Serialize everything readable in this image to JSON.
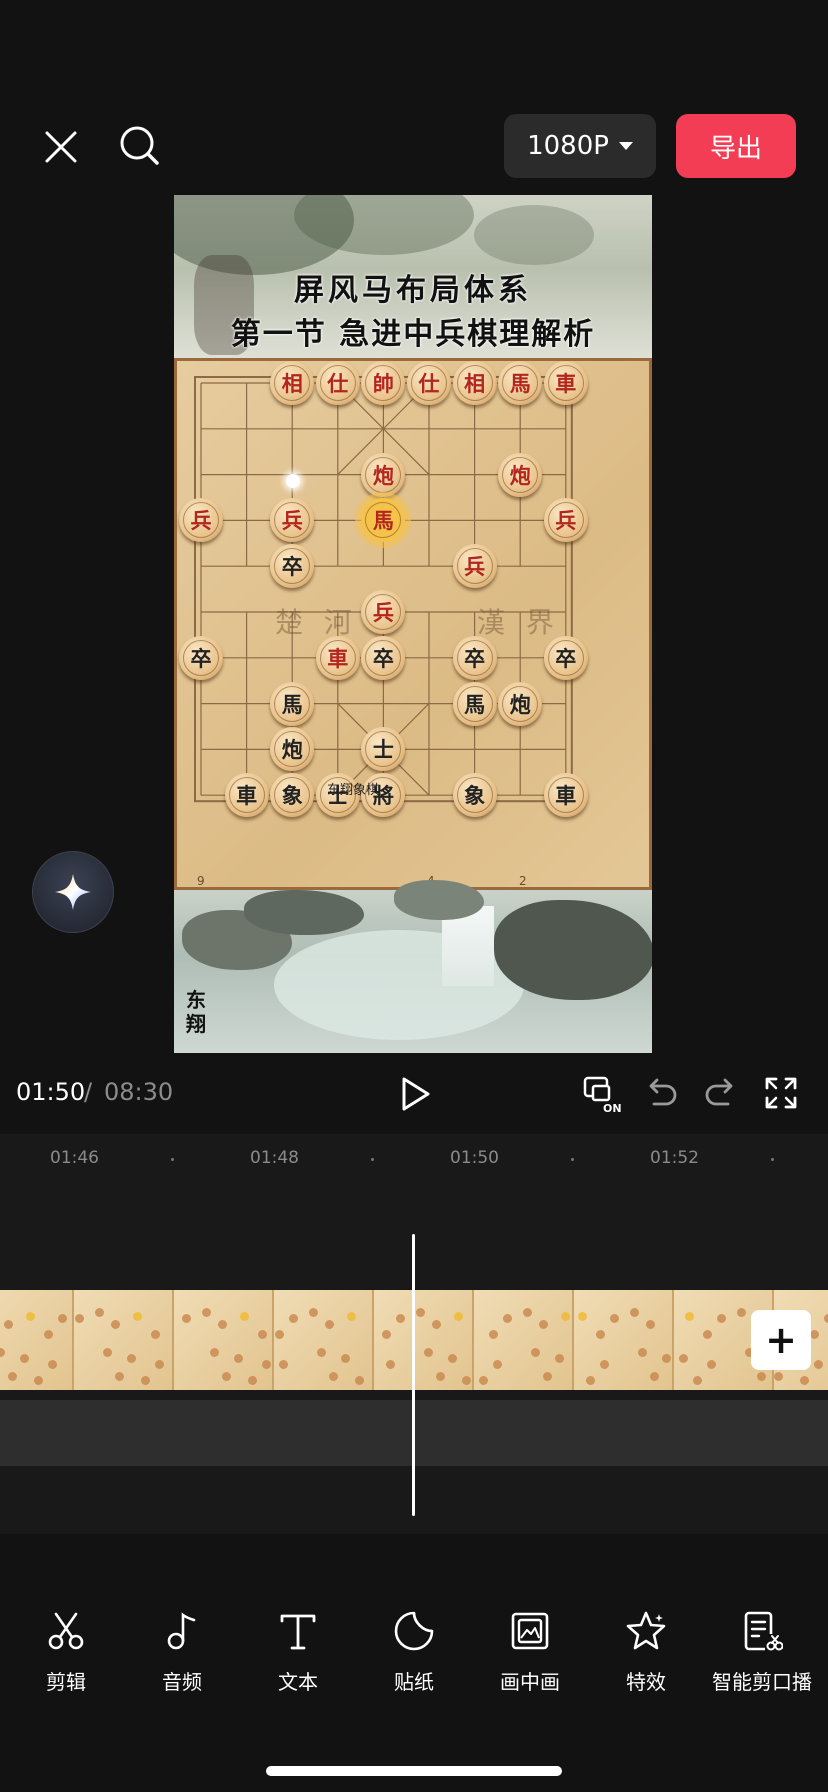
{
  "header": {
    "resolution_label": "1080P",
    "export_label": "导出",
    "icons": [
      "close-icon",
      "search-icon",
      "caret-down-icon"
    ]
  },
  "preview": {
    "title_line_1": "屏风马布局体系",
    "title_line_2": "第一节  急进中兵棋理解析",
    "river_left": "楚 河",
    "river_right": "漢 界",
    "watermark": "东翔象棋",
    "author": "东翔",
    "file_numbers": [
      "9",
      "4",
      "2"
    ],
    "pieces": [
      {
        "text": "相",
        "side": "red",
        "col": 2,
        "row": 0
      },
      {
        "text": "仕",
        "side": "red",
        "col": 3,
        "row": 0
      },
      {
        "text": "帥",
        "side": "red",
        "col": 4,
        "row": 0
      },
      {
        "text": "仕",
        "side": "red",
        "col": 5,
        "row": 0
      },
      {
        "text": "相",
        "side": "red",
        "col": 6,
        "row": 0
      },
      {
        "text": "馬",
        "side": "red",
        "col": 7,
        "row": 0
      },
      {
        "text": "車",
        "side": "red",
        "col": 8,
        "row": 0
      },
      {
        "text": "炮",
        "side": "red",
        "col": 4,
        "row": 2
      },
      {
        "text": "炮",
        "side": "red",
        "col": 7,
        "row": 2
      },
      {
        "text": "兵",
        "side": "red",
        "col": 0,
        "row": 3
      },
      {
        "text": "兵",
        "side": "red",
        "col": 2,
        "row": 3
      },
      {
        "text": "馬",
        "side": "red",
        "col": 4,
        "row": 3,
        "highlight": true
      },
      {
        "text": "兵",
        "side": "red",
        "col": 8,
        "row": 3
      },
      {
        "text": "卒",
        "side": "black",
        "col": 2,
        "row": 4
      },
      {
        "text": "兵",
        "side": "red",
        "col": 6,
        "row": 4
      },
      {
        "text": "兵",
        "side": "red",
        "col": 4,
        "row": 5
      },
      {
        "text": "卒",
        "side": "black",
        "col": 0,
        "row": 6
      },
      {
        "text": "車",
        "side": "red",
        "col": 3,
        "row": 6
      },
      {
        "text": "卒",
        "side": "black",
        "col": 4,
        "row": 6
      },
      {
        "text": "卒",
        "side": "black",
        "col": 6,
        "row": 6
      },
      {
        "text": "卒",
        "side": "black",
        "col": 8,
        "row": 6
      },
      {
        "text": "馬",
        "side": "black",
        "col": 2,
        "row": 7
      },
      {
        "text": "馬",
        "side": "black",
        "col": 6,
        "row": 7
      },
      {
        "text": "炮",
        "side": "black",
        "col": 7,
        "row": 7
      },
      {
        "text": "炮",
        "side": "black",
        "col": 2,
        "row": 8
      },
      {
        "text": "士",
        "side": "black",
        "col": 4,
        "row": 8
      },
      {
        "text": "車",
        "side": "black",
        "col": 1,
        "row": 9
      },
      {
        "text": "象",
        "side": "black",
        "col": 2,
        "row": 9
      },
      {
        "text": "士",
        "side": "black",
        "col": 3,
        "row": 9
      },
      {
        "text": "將",
        "side": "black",
        "col": 4,
        "row": 9
      },
      {
        "text": "象",
        "side": "black",
        "col": 6,
        "row": 9
      },
      {
        "text": "車",
        "side": "black",
        "col": 8,
        "row": 9
      }
    ]
  },
  "ai_assistant_icon": "sparkle-icon",
  "playback": {
    "current_time": "01:50",
    "separator": "/",
    "total_time": "08:30",
    "icons": [
      "play-icon",
      "keyframe-on-icon",
      "undo-icon",
      "redo-icon",
      "fullscreen-icon"
    ]
  },
  "timeline": {
    "ruler": [
      "01:46",
      "01:48",
      "01:50",
      "01:52"
    ],
    "add_icon": "plus-icon"
  },
  "toolbar": {
    "items": [
      {
        "label": "剪辑",
        "icon": "scissors-icon"
      },
      {
        "label": "音频",
        "icon": "music-note-icon"
      },
      {
        "label": "文本",
        "icon": "text-icon"
      },
      {
        "label": "贴纸",
        "icon": "sticker-icon"
      },
      {
        "label": "画中画",
        "icon": "picture-in-picture-icon"
      },
      {
        "label": "特效",
        "icon": "effects-star-icon"
      },
      {
        "label": "智能剪口播",
        "icon": "smart-cut-icon"
      }
    ]
  }
}
